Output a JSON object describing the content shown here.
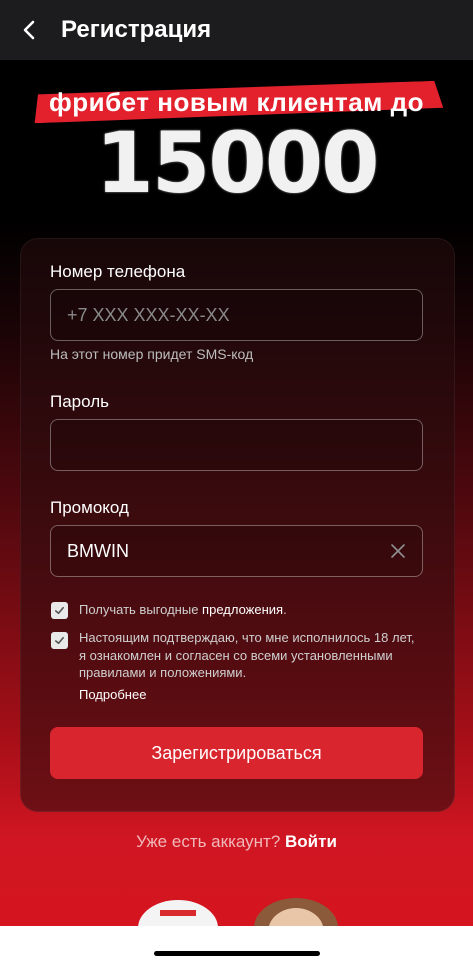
{
  "header": {
    "title": "Регистрация",
    "back_icon": "chevron-left-icon"
  },
  "promo": {
    "text": "фрибет новым клиентам до",
    "amount": "15000"
  },
  "form": {
    "phone": {
      "label": "Номер телефона",
      "placeholder": "+7 XXX XXX-XX-XX",
      "value": "",
      "hint": "На этот номер придет SMS-код"
    },
    "password": {
      "label": "Пароль",
      "value": ""
    },
    "promocode": {
      "label": "Промокод",
      "value": "BMWIN",
      "clear_icon": "close-icon"
    },
    "offers_checkbox": {
      "checked": true,
      "text": "Получать выгодные",
      "link": "предложения",
      "suffix": "."
    },
    "terms_checkbox": {
      "checked": true,
      "text": "Настоящим подтверждаю, что мне исполнилось 18 лет, я ознакомлен и согласен со всеми установленными правилами и положениями.",
      "more_link": "Подробнее"
    },
    "submit_label": "Зарегистрироваться"
  },
  "login": {
    "question": "Уже есть аккаунт?",
    "link": "Войти"
  },
  "colors": {
    "accent": "#d9262e",
    "banner": "#e2212d",
    "header_bg": "#1c1c1e"
  }
}
